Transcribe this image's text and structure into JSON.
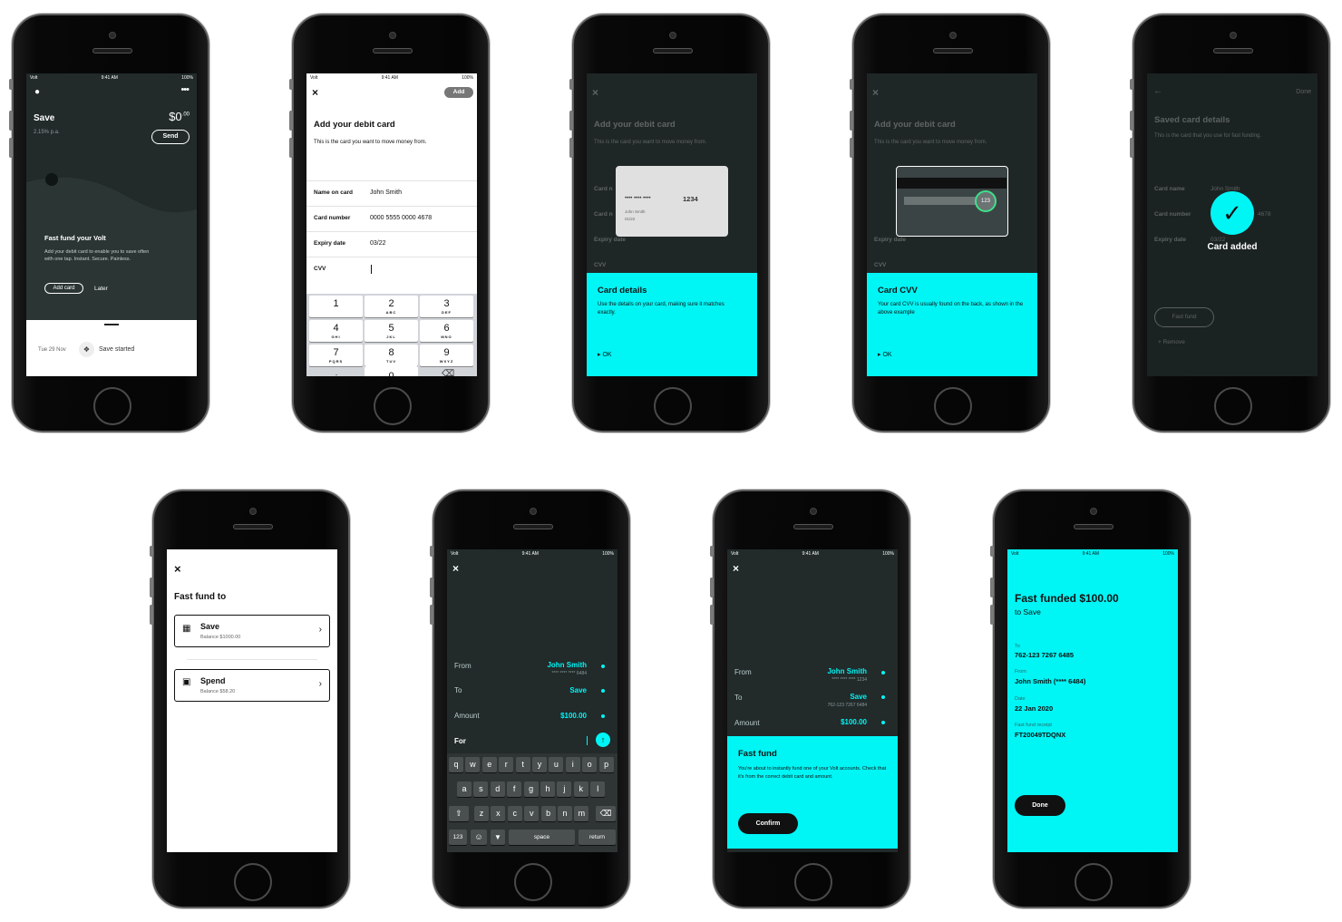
{
  "status": {
    "carrier": "Volt",
    "time": "9:41 AM",
    "battery": "100%"
  },
  "s1": {
    "title": "Save",
    "amount": "$0",
    "cents": ".00",
    "rate": "2.15% p.a.",
    "send": "Send",
    "ff_title": "Fast fund your Volt",
    "ff_body": "Add your debit card to enable you to save often with one tap. Instant. Secure. Painless.",
    "add_card": "Add card",
    "later": "Later",
    "date": "Tue 29 Nov",
    "event": "Save started"
  },
  "s2": {
    "add": "Add",
    "title": "Add your debit card",
    "subtitle": "This is the card you want to move money from.",
    "fields": [
      {
        "label": "Name on card",
        "value": "John Smith"
      },
      {
        "label": "Card number",
        "value": "0000 5555 0000 4678"
      },
      {
        "label": "Expiry date",
        "value": "03/22"
      },
      {
        "label": "CVV",
        "value": ""
      }
    ],
    "keys": [
      {
        "n": "1",
        "l": ""
      },
      {
        "n": "2",
        "l": "ABC"
      },
      {
        "n": "3",
        "l": "DEF"
      },
      {
        "n": "4",
        "l": "GHI"
      },
      {
        "n": "5",
        "l": "JKL"
      },
      {
        "n": "6",
        "l": "MNO"
      },
      {
        "n": "7",
        "l": "PQRS"
      },
      {
        "n": "8",
        "l": "TUV"
      },
      {
        "n": "9",
        "l": "WXYZ"
      }
    ],
    "dot": ".",
    "zero": "0"
  },
  "s3": {
    "card_digits": "1234",
    "card_mask": "••••  ••••  ••••",
    "card_name": "John Smith",
    "card_exp": "01/22",
    "panel_title": "Card details",
    "panel_body": "Use the details on your card, making sure it matches exactly.",
    "ok": "OK"
  },
  "s4": {
    "cvv": "123",
    "panel_title": "Card CVV",
    "panel_body": "Your card CVV is usually found on the back, as shown in the above example",
    "ok": "OK"
  },
  "s5": {
    "done": "Done",
    "title": "Saved card details",
    "subtitle": "This is the card that you use for fast funding.",
    "name_label": "Card name",
    "name_value": "John Smith",
    "num_label": "Card number",
    "num_value": "4678",
    "exp_label": "Expiry date",
    "exp_value": "03/22",
    "fast_fund": "Fast fund",
    "remove": "Remove",
    "added": "Card added"
  },
  "s6": {
    "title": "Fast fund to",
    "save": "Save",
    "save_bal": "Balance $1000.00",
    "spend": "Spend",
    "spend_bal": "Balance $58.20"
  },
  "s7": {
    "from": "From",
    "from_name": "John Smith",
    "from_acc": "**** **** **** 6484",
    "to": "To",
    "to_val": "Save",
    "amount": "Amount",
    "amount_val": "$100.00",
    "for": "For",
    "row1": [
      "q",
      "w",
      "e",
      "r",
      "t",
      "y",
      "u",
      "i",
      "o",
      "p"
    ],
    "row2": [
      "a",
      "s",
      "d",
      "f",
      "g",
      "h",
      "j",
      "k",
      "l"
    ],
    "row3": [
      "z",
      "x",
      "c",
      "v",
      "b",
      "n",
      "m"
    ],
    "k123": "123",
    "space": "space",
    "return": "return"
  },
  "s8": {
    "from": "From",
    "from_name": "John Smith",
    "from_acc": "**** **** **** 1234",
    "to": "To",
    "to_val": "Save",
    "to_acc": "762-123  7267 6484",
    "amount": "Amount",
    "amount_val": "$100.00",
    "panel_title": "Fast fund",
    "panel_body": "You're about to instantly fund one of your Volt accounts. Check that it's from the correct debit card and amount.",
    "confirm": "Confirm"
  },
  "s9": {
    "title": "Fast funded $100.00",
    "sub": "to Save",
    "to_label": "To",
    "to_val": "762-123  7267 6485",
    "from_label": "From",
    "from_val": "John Smith (**** 6484)",
    "date_label": "Date",
    "date_val": "22 Jan 2020",
    "rec_label": "Fast fund receipt",
    "rec_val": "FT20049TDQNX",
    "done": "Done"
  }
}
